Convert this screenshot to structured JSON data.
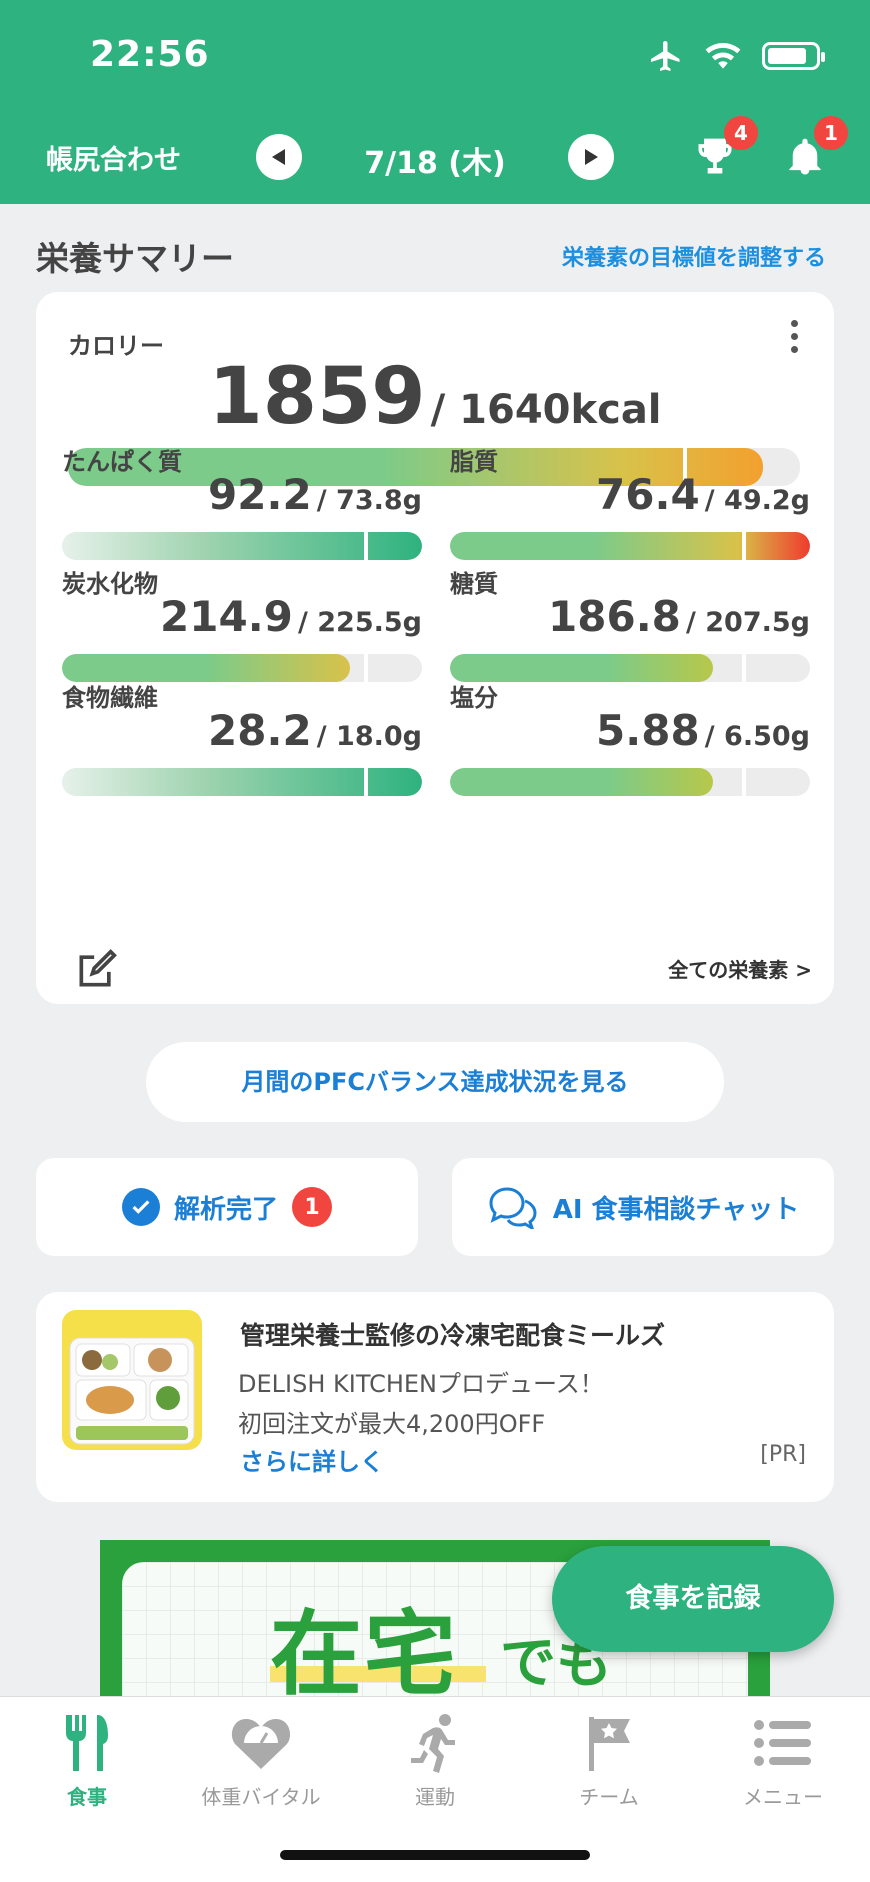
{
  "status_bar": {
    "time": "22:56"
  },
  "header": {
    "left_label": "帳尻合わせ",
    "date": "7/18 (木)",
    "trophy_badge": "4",
    "bell_badge": "1"
  },
  "summary": {
    "title": "栄養サマリー",
    "adjust_link": "栄養素の目標値を調整する",
    "calorie": {
      "label": "カロリー",
      "value": "1859",
      "target": "/ 1640kcal",
      "progress": 0.95,
      "target_ratio": 0.84
    },
    "nutrients": [
      {
        "label": "たんぱく質",
        "value": "92.2",
        "target": "/ 73.8g",
        "progress": 1.0,
        "target_ratio": 0.84,
        "style": "teal"
      },
      {
        "label": "脂質",
        "value": "76.4",
        "target": "/ 49.2g",
        "progress": 1.0,
        "target_ratio": 0.81,
        "style": "red"
      },
      {
        "label": "炭水化物",
        "value": "214.9",
        "target": "/ 225.5g",
        "progress": 0.8,
        "target_ratio": 0.84,
        "style": "yellow"
      },
      {
        "label": "糖質",
        "value": "186.8",
        "target": "/ 207.5g",
        "progress": 0.73,
        "target_ratio": 0.81,
        "style": "green"
      },
      {
        "label": "食物繊維",
        "value": "28.2",
        "target": "/ 18.0g",
        "progress": 1.0,
        "target_ratio": 0.84,
        "style": "teal"
      },
      {
        "label": "塩分",
        "value": "5.88",
        "target": "/ 6.50g",
        "progress": 0.73,
        "target_ratio": 0.81,
        "style": "green"
      }
    ],
    "all_nutrients_link": "全ての栄養素 >"
  },
  "pfc_button": "月間のPFCバランス達成状況を見る",
  "analysis_button": {
    "label": "解析完了",
    "badge": "1"
  },
  "ai_button": "AI 食事相談チャット",
  "ad": {
    "title": "管理栄養士監修の冷凍宅配食ミールズ",
    "line1": "DELISH KITCHENプロデュース！",
    "line2": "初回注文が最大4,200円OFF",
    "link": "さらに詳しく",
    "pr": "[PR]"
  },
  "banner": {
    "text_main": "在宅",
    "text_sub": "でも"
  },
  "fab": "食事を記録",
  "tabs": [
    {
      "label": "食事",
      "icon": "fork-knife-icon",
      "active": true
    },
    {
      "label": "体重バイタル",
      "icon": "heart-scale-icon",
      "active": false
    },
    {
      "label": "運動",
      "icon": "running-icon",
      "active": false
    },
    {
      "label": "チーム",
      "icon": "flag-icon",
      "active": false
    },
    {
      "label": "メニュー",
      "icon": "menu-list-icon",
      "active": false
    }
  ],
  "colors": {
    "brand": "#2eb27f",
    "link": "#1c7fd6",
    "badge": "#f0463f"
  }
}
